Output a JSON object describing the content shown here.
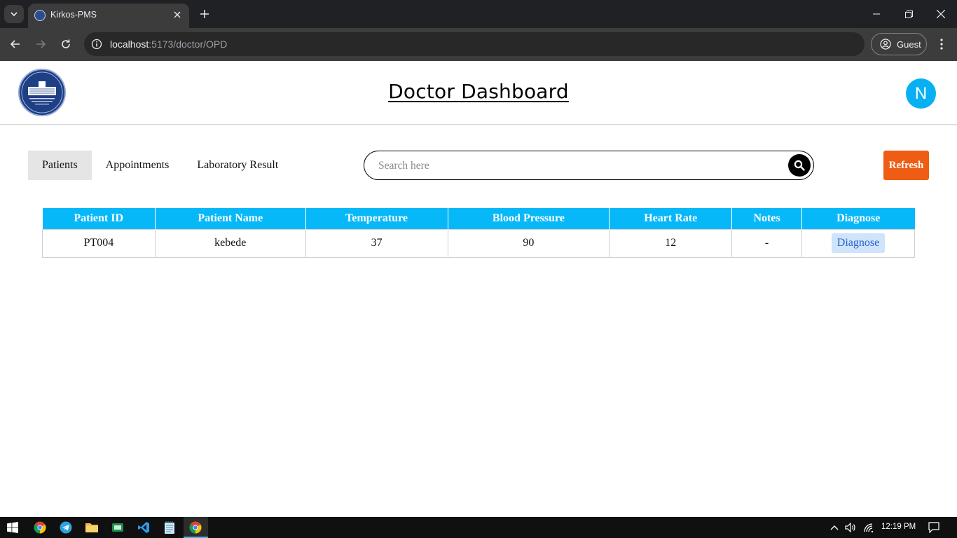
{
  "browser": {
    "tab_title": "Kirkos-PMS",
    "url_host": "localhost",
    "url_path": ":5173/doctor/OPD",
    "profile_label": "Guest"
  },
  "header": {
    "title": "Doctor Dashboard",
    "avatar_initial": "N"
  },
  "nav": {
    "tabs": [
      {
        "label": "Patients",
        "active": true
      },
      {
        "label": "Appointments",
        "active": false
      },
      {
        "label": "Laboratory Result",
        "active": false
      }
    ]
  },
  "search": {
    "placeholder": "Search here"
  },
  "refresh_label": "Refresh",
  "table": {
    "columns": [
      "Patient ID",
      "Patient Name",
      "Temperature",
      "Blood Pressure",
      "Heart Rate",
      "Notes",
      "Diagnose"
    ],
    "rows": [
      {
        "patient_id": "PT004",
        "patient_name": "kebede",
        "temperature": "37",
        "blood_pressure": "90",
        "heart_rate": "12",
        "notes": "-",
        "action_label": "Diagnose"
      }
    ]
  },
  "taskbar": {
    "time": "12:19 PM"
  },
  "colors": {
    "accent": "#07b8f9",
    "refresh": "#ef5c13",
    "avatar": "#07b0f2",
    "diagnose_bg": "#cfe3fb",
    "diagnose_text": "#2763c9"
  }
}
